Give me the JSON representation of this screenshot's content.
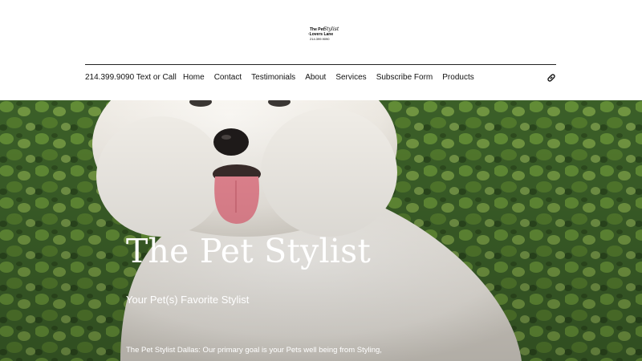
{
  "logo": {
    "line1": "The Pet",
    "swash": "Stylist",
    "line2": "·Lovers Lane",
    "line3": "214.399.9090"
  },
  "header": {
    "phone": "214.399.9090 Text or Call",
    "nav": [
      "Home",
      "Contact",
      "Testimonials",
      "About",
      "Services",
      "Subscribe Form",
      "Products"
    ],
    "link_icon": "link-icon"
  },
  "hero": {
    "title": "The Pet Stylist",
    "subtitle": "Your Pet(s) Favorite Stylist",
    "body": "The Pet Stylist Dallas: Our primary goal is your Pets well being from Styling,"
  },
  "colors": {
    "header_bg": "#ffffff",
    "rule": "#222222",
    "hedge_green": "#3b5f28",
    "dog_white": "#f2f0ec",
    "tongue_pink": "#e58591",
    "hero_text": "#ffffff"
  }
}
